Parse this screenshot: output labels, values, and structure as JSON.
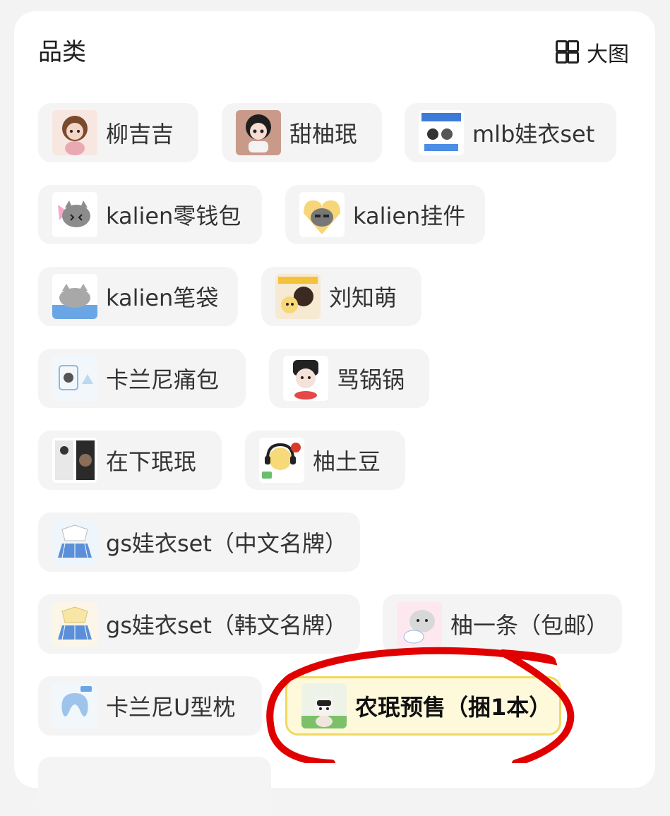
{
  "section": {
    "title": "品类",
    "view_toggle_label": "大图"
  },
  "categories": [
    {
      "label": "柳吉吉",
      "thumb": "doll-brown-hair",
      "selected": false
    },
    {
      "label": "甜柚珉",
      "thumb": "doll-black-hair",
      "selected": false
    },
    {
      "label": "mlb娃衣set",
      "thumb": "doll-clothes-set",
      "selected": false
    },
    {
      "label": "kalien零钱包",
      "thumb": "cat-coin-purse",
      "selected": false
    },
    {
      "label": "kalien挂件",
      "thumb": "cat-pendant",
      "selected": false
    },
    {
      "label": "kalien笔袋",
      "thumb": "cat-pencil-case",
      "selected": false
    },
    {
      "label": "刘知萌",
      "thumb": "doll-yellow-hair",
      "selected": false
    },
    {
      "label": "卡兰尼痛包",
      "thumb": "itabag",
      "selected": false
    },
    {
      "label": "骂锅锅",
      "thumb": "doll-panda-hair",
      "selected": false
    },
    {
      "label": "在下珉珉",
      "thumb": "photo-card-sheet",
      "selected": false
    },
    {
      "label": "柚土豆",
      "thumb": "doll-headphones",
      "selected": false
    },
    {
      "label": "gs娃衣set（中文名牌）",
      "thumb": "doll-uniform-blue",
      "selected": false
    },
    {
      "label": "gs娃衣set（韩文名牌）",
      "thumb": "doll-uniform-yellow",
      "selected": false
    },
    {
      "label": "柚一条（包邮）",
      "thumb": "doll-pillow",
      "selected": false
    },
    {
      "label": "卡兰尼U型枕",
      "thumb": "u-pillow",
      "selected": false
    },
    {
      "label": "农珉预售（捆1本）",
      "thumb": "doll-bunny",
      "selected": true
    }
  ],
  "colors": {
    "background": "#f3f3f3",
    "card": "#ffffff",
    "chip": "#f4f4f4",
    "selected_chip": "#fff9dc",
    "selected_border": "#f0d860",
    "annotation": "#e00000"
  }
}
